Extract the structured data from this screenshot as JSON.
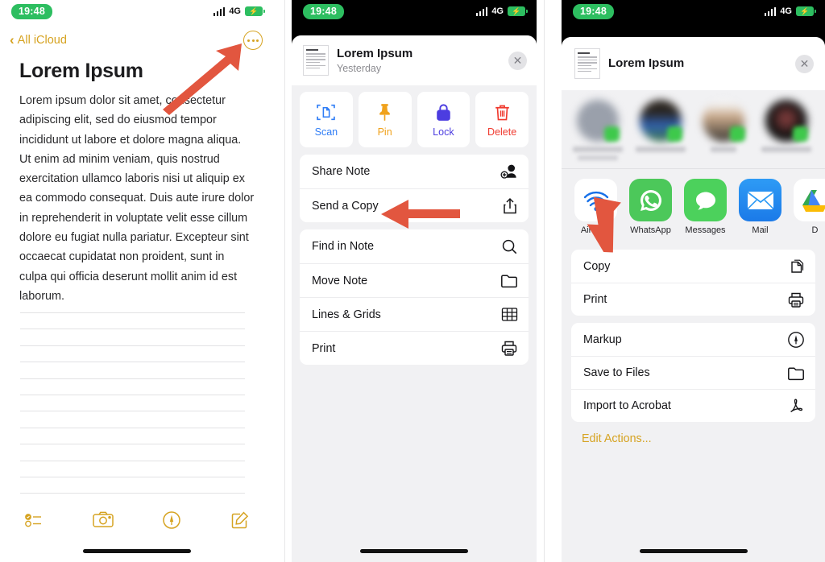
{
  "status_bar": {
    "time": "19:48",
    "network": "4G",
    "battery_charging": true
  },
  "panel1": {
    "back_label": "All iCloud",
    "more_icon": "ellipsis-circle-icon",
    "note_title": "Lorem Ipsum",
    "note_body": "Lorem ipsum dolor sit amet, consectetur adipiscing elit, sed do eiusmod tempor incididunt ut labore et dolore magna aliqua. Ut enim ad minim veniam, quis nostrud exercitation ullamco laboris nisi ut aliquip ex ea commodo consequat. Duis aute irure dolor in reprehenderit in voluptate velit esse cillum dolore eu fugiat nulla pariatur. Excepteur sint occaecat cupidatat non proident, sunt in culpa qui officia deserunt mollit anim id est laborum.",
    "toolbar": [
      {
        "name": "checklist-icon"
      },
      {
        "name": "camera-icon"
      },
      {
        "name": "markup-icon"
      },
      {
        "name": "compose-icon"
      }
    ],
    "annotation_arrow": "points to more-options button"
  },
  "panel2": {
    "header": {
      "title": "Lorem Ipsum",
      "subtitle": "Yesterday",
      "close_icon": "close-icon"
    },
    "quick_actions": [
      {
        "label": "Scan",
        "icon": "document-scan-icon",
        "color": "#2f7df6"
      },
      {
        "label": "Pin",
        "icon": "pin-icon",
        "color": "#f0a21c"
      },
      {
        "label": "Lock",
        "icon": "lock-icon",
        "color": "#4c3de0"
      },
      {
        "label": "Delete",
        "icon": "trash-icon",
        "color": "#f03a2f"
      }
    ],
    "menu_group_1": [
      {
        "label": "Share Note",
        "icon": "person-add-icon"
      },
      {
        "label": "Send a Copy",
        "icon": "share-icon"
      }
    ],
    "menu_group_2": [
      {
        "label": "Find in Note",
        "icon": "search-icon"
      },
      {
        "label": "Move Note",
        "icon": "folder-icon"
      },
      {
        "label": "Lines & Grids",
        "icon": "grid-icon"
      },
      {
        "label": "Print",
        "icon": "printer-icon"
      }
    ],
    "annotation_arrow": "points to Send a Copy"
  },
  "panel3": {
    "header": {
      "title": "Lorem Ipsum",
      "close_icon": "close-icon"
    },
    "contacts": [
      {
        "name": "",
        "blurred": true
      },
      {
        "name": "",
        "blurred": true
      },
      {
        "name": "",
        "blurred": true
      },
      {
        "name": "",
        "blurred": true
      }
    ],
    "apps": [
      {
        "label": "AirDrop",
        "icon": "airdrop-icon"
      },
      {
        "label": "WhatsApp",
        "icon": "whatsapp-icon"
      },
      {
        "label": "Messages",
        "icon": "messages-icon"
      },
      {
        "label": "Mail",
        "icon": "mail-icon"
      },
      {
        "label": "D",
        "icon": "google-drive-icon"
      }
    ],
    "menu_group_1": [
      {
        "label": "Copy",
        "icon": "copy-icon"
      },
      {
        "label": "Print",
        "icon": "printer-icon"
      }
    ],
    "menu_group_2": [
      {
        "label": "Markup",
        "icon": "markup-icon"
      },
      {
        "label": "Save to Files",
        "icon": "folder-icon"
      },
      {
        "label": "Import to Acrobat",
        "icon": "acrobat-icon"
      }
    ],
    "edit_actions_label": "Edit Actions...",
    "annotation_arrow": "points to Markup"
  },
  "colors": {
    "accent_gold": "#d6a321",
    "arrow_red": "#e2563f",
    "green": "#2dbe60"
  }
}
